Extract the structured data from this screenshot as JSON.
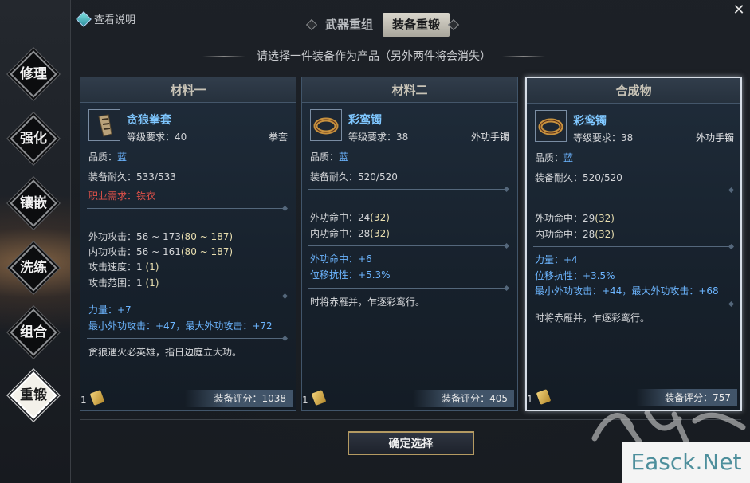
{
  "help": {
    "label": "查看说明"
  },
  "close_glyph": "✕",
  "tabs": [
    {
      "label": "武器重组",
      "active": false
    },
    {
      "label": "装备重锻",
      "active": true
    }
  ],
  "subtitle": "请选择一件装备作为产品（另外两件将会消失）",
  "menu": [
    {
      "label": "修理"
    },
    {
      "label": "强化"
    },
    {
      "label": "镶嵌"
    },
    {
      "label": "洗练"
    },
    {
      "label": "组合"
    },
    {
      "label": "重锻",
      "active": true
    }
  ],
  "panels": [
    {
      "header": "材料一",
      "item": {
        "name": "贪狼拳套",
        "level": "等级要求：40",
        "type": "拳套",
        "icon": "gauntlet-icon"
      },
      "quality_label": "品质：",
      "quality_value": "蓝",
      "durability": "装备耐久：533/533",
      "requirement_label": "职业需求：",
      "requirement_value": "铁衣",
      "stats": [
        {
          "label": "外功攻击：",
          "value": "56 ~ 173",
          "extra": "(80 ~ 187)"
        },
        {
          "label": "内功攻击：",
          "value": "56 ~ 161",
          "extra": "(80 ~ 187)"
        },
        {
          "label": "攻击速度：",
          "value": "1",
          "extra": "(1)"
        },
        {
          "label": "攻击范围：",
          "value": "1",
          "extra": "(1)"
        }
      ],
      "bonus": [
        "力量：+7",
        "最小外功攻击：+47，最大外功攻击：+72"
      ],
      "description": "贪狼遇火必英雄，指日边庭立大功。",
      "count": "1",
      "score": "装备评分：1038"
    },
    {
      "header": "材料二",
      "item": {
        "name": "彩鸾镯",
        "level": "等级要求：38",
        "type": "外功手镯",
        "icon": "bracelet-icon"
      },
      "quality_label": "品质：",
      "quality_value": "蓝",
      "durability": "装备耐久：520/520",
      "stats": [
        {
          "label": "外功命中：",
          "value": "24",
          "extra": "(32)"
        },
        {
          "label": "内功命中：",
          "value": "28",
          "extra": "(32)"
        }
      ],
      "bonus": [
        "外功命中：+6",
        "位移抗性：+5.3%"
      ],
      "description": "时将赤雁并，乍逐彩鸾行。",
      "count": "1",
      "score": "装备评分：405"
    },
    {
      "header": "合成物",
      "item": {
        "name": "彩鸾镯",
        "level": "等级要求：38",
        "type": "外功手镯",
        "icon": "bracelet-icon"
      },
      "quality_label": "品质：",
      "quality_value": "蓝",
      "durability": "装备耐久：520/520",
      "stats": [
        {
          "label": "外功命中：",
          "value": "29",
          "extra": "(32)"
        },
        {
          "label": "内功命中：",
          "value": "28",
          "extra": "(32)"
        }
      ],
      "bonus": [
        "力量：+4",
        "位移抗性：+3.5%",
        "最小外功攻击：+44，最大外功攻击：+68"
      ],
      "description": "时将赤雁并，乍逐彩鸾行。",
      "count": "1",
      "score": "装备评分：757"
    }
  ],
  "confirm_label": "确定选择",
  "watermark": "Easck.Net",
  "colors": {
    "accent_blue": "#6cb5ff",
    "item_name": "#7fc7ff",
    "requirement_red": "#e0524a",
    "stat_extra": "#e9dfb0"
  }
}
